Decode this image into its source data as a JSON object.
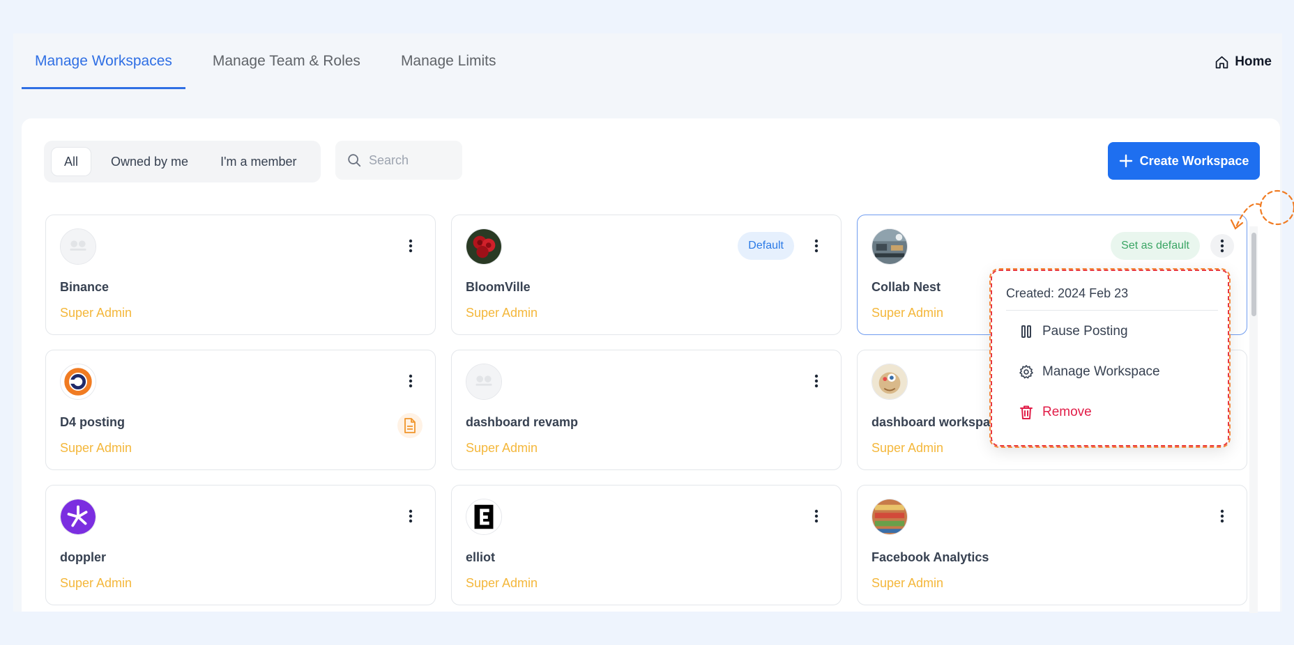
{
  "tabs": [
    {
      "label": "Manage Workspaces",
      "active": true
    },
    {
      "label": "Manage Team & Roles",
      "active": false
    },
    {
      "label": "Manage Limits",
      "active": false
    }
  ],
  "home_label": "Home",
  "filters": [
    {
      "label": "All",
      "active": true
    },
    {
      "label": "Owned by me",
      "active": false
    },
    {
      "label": "I'm a member",
      "active": false
    }
  ],
  "search": {
    "placeholder": "Search",
    "value": ""
  },
  "create_button": "Create Workspace",
  "workspaces": [
    {
      "name": "Binance",
      "role": "Super Admin",
      "avatar": "no-photo-placeholder"
    },
    {
      "name": "BloomVille",
      "role": "Super Admin",
      "avatar": "red-roses-photo",
      "badge": "Default"
    },
    {
      "name": "Collab Nest",
      "role": "Super Admin",
      "avatar": "office-photo",
      "badge": "Set as default"
    },
    {
      "name": "D4 posting",
      "role": "Super Admin",
      "avatar": "orange-ring-logo",
      "icon": "document-icon"
    },
    {
      "name": "dashboard revamp",
      "role": "Super Admin",
      "avatar": "no-photo-placeholder"
    },
    {
      "name": "dashboard workspac",
      "role": "Super Admin",
      "avatar": "cartoon-character"
    },
    {
      "name": "doppler",
      "role": "Super Admin",
      "avatar": "purple-star-logo"
    },
    {
      "name": "elliot",
      "role": "Super Admin",
      "avatar": "black-e-logo"
    },
    {
      "name": "Facebook Analytics",
      "role": "Super Admin",
      "avatar": "store-shelves-photo"
    }
  ],
  "menu": {
    "created": "Created: 2024 Feb 23",
    "items": [
      {
        "label": "Pause Posting",
        "icon": "pause-icon"
      },
      {
        "label": "Manage Workspace",
        "icon": "gear-icon"
      },
      {
        "label": "Remove",
        "icon": "trash-icon"
      }
    ]
  },
  "colors": {
    "accent": "#1e6ff0",
    "role": "#f4b73b",
    "danger": "#e11d48",
    "annotation": "#f5893a"
  }
}
